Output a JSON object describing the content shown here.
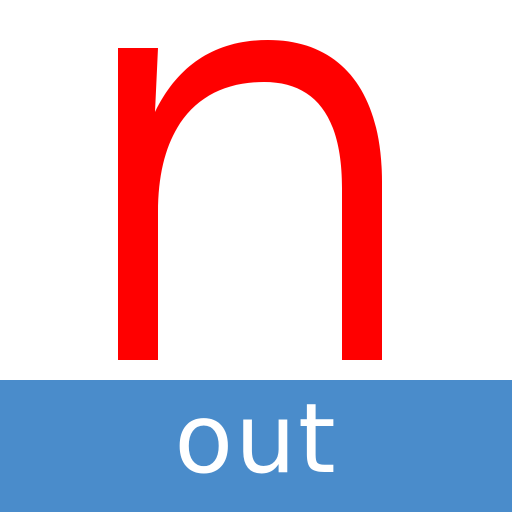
{
  "icon": {
    "glyph": "n",
    "label": "out",
    "colors": {
      "background": "#ffffff",
      "glyph": "#ff0000",
      "band": "#4a8ccb",
      "label": "#ffffff"
    }
  }
}
